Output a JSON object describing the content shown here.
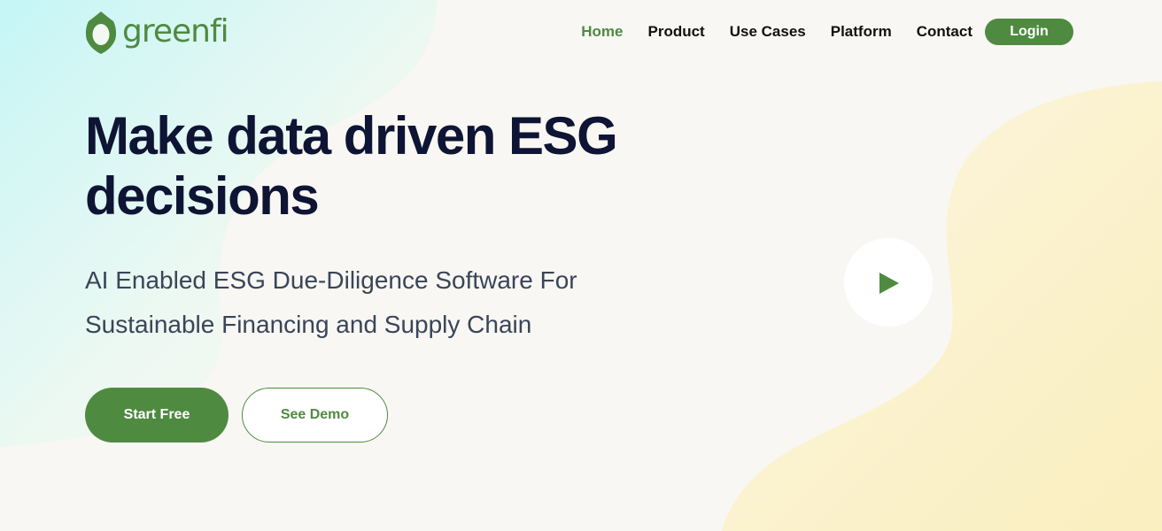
{
  "brand": {
    "name": "greenfi",
    "logo_icon": "leaf-ring-icon",
    "primary_color": "#4f8a41",
    "heading_color": "#0e1433",
    "body_color": "#3a4558"
  },
  "nav": {
    "items": [
      {
        "label": "Home",
        "active": true
      },
      {
        "label": "Product",
        "active": false
      },
      {
        "label": "Use Cases",
        "active": false
      },
      {
        "label": "Platform",
        "active": false
      },
      {
        "label": "Contact",
        "active": false
      }
    ],
    "login_label": "Login"
  },
  "hero": {
    "title_line1": "Make data driven ESG",
    "title_line2": "decisions",
    "subtitle_line1": "AI Enabled ESG Due-Diligence Software For",
    "subtitle_line2": "Sustainable Financing and Supply Chain",
    "start_label": "Start Free",
    "demo_label": "See Demo",
    "play_icon": "play-icon"
  }
}
